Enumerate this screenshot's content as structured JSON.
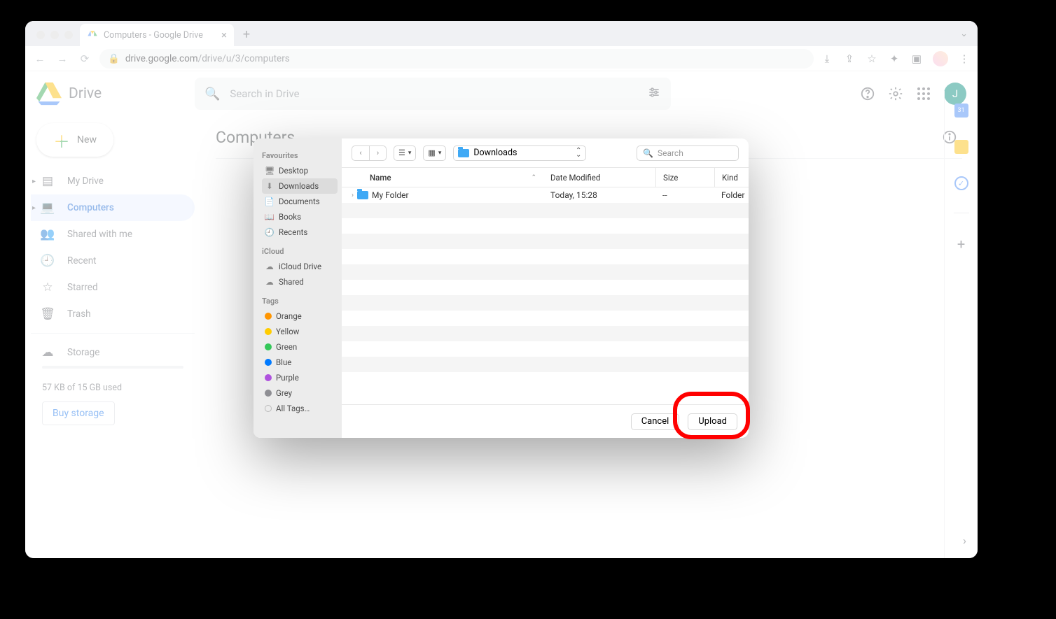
{
  "browser": {
    "tab_title": "Computers - Google Drive",
    "url_host": "drive.google.com",
    "url_path": "/drive/u/3/computers"
  },
  "drive": {
    "product": "Drive",
    "search_placeholder": "Search in Drive",
    "avatar_letter": "J",
    "new_label": "New",
    "sidebar": [
      {
        "label": "My Drive",
        "expandable": true
      },
      {
        "label": "Computers",
        "expandable": true,
        "active": true
      },
      {
        "label": "Shared with me"
      },
      {
        "label": "Recent"
      },
      {
        "label": "Starred"
      },
      {
        "label": "Trash"
      }
    ],
    "storage_label": "Storage",
    "storage_usage": "57 KB of 15 GB used",
    "buy_label": "Buy storage",
    "main_title": "Computers"
  },
  "finder": {
    "sidebar": {
      "favourites_header": "Favourites",
      "favourites": [
        "Desktop",
        "Downloads",
        "Documents",
        "Books",
        "Recents"
      ],
      "icloud_header": "iCloud",
      "icloud": [
        "iCloud Drive",
        "Shared"
      ],
      "tags_header": "Tags",
      "tags": [
        {
          "label": "Orange",
          "color": "#ff9500"
        },
        {
          "label": "Yellow",
          "color": "#ffcc00"
        },
        {
          "label": "Green",
          "color": "#34c759"
        },
        {
          "label": "Blue",
          "color": "#007aff"
        },
        {
          "label": "Purple",
          "color": "#af52de"
        },
        {
          "label": "Grey",
          "color": "#8e8e93"
        },
        {
          "label": "All Tags…",
          "color": null
        }
      ]
    },
    "location": "Downloads",
    "search_placeholder": "Search",
    "columns": {
      "name": "Name",
      "date": "Date Modified",
      "size": "Size",
      "kind": "Kind"
    },
    "rows": [
      {
        "name": "My Folder",
        "date": "Today, 15:28",
        "size": "--",
        "kind": "Folder"
      }
    ],
    "cancel_label": "Cancel",
    "upload_label": "Upload"
  }
}
